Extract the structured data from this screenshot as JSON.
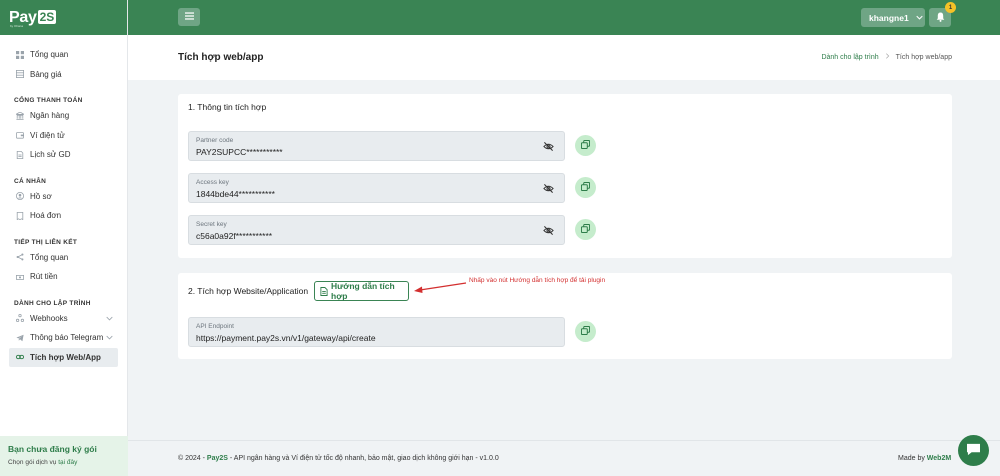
{
  "brand": {
    "logo_text": "Pay",
    "logo_box": "2S",
    "logo_sub": "by Ohana"
  },
  "sidebar": {
    "top_items": [
      {
        "label": "Tổng quan",
        "icon": "grid-icon"
      },
      {
        "label": "Bảng giá",
        "icon": "table-icon"
      }
    ],
    "sections": [
      {
        "title": "CỔNG THANH TOÁN",
        "items": [
          {
            "label": "Ngân hàng",
            "icon": "bank-icon"
          },
          {
            "label": "Ví điện tử",
            "icon": "wallet-icon"
          },
          {
            "label": "Lịch sử GD",
            "icon": "file-icon"
          }
        ]
      },
      {
        "title": "CÁ NHÂN",
        "items": [
          {
            "label": "Hồ sơ",
            "icon": "user-icon"
          },
          {
            "label": "Hoá đơn",
            "icon": "receipt-icon"
          }
        ]
      },
      {
        "title": "TIẾP THỊ LIÊN KẾT",
        "items": [
          {
            "label": "Tổng quan",
            "icon": "network-icon"
          },
          {
            "label": "Rút tiền",
            "icon": "withdraw-icon"
          }
        ]
      },
      {
        "title": "DÀNH CHO LẬP TRÌNH",
        "items": [
          {
            "label": "Webhooks",
            "icon": "webhook-icon"
          },
          {
            "label": "Thông báo Telegram",
            "icon": "telegram-icon"
          },
          {
            "label": "Tích hợp Web/App",
            "icon": "link-icon"
          }
        ]
      }
    ],
    "promo": {
      "title": "Bạn chưa đăng ký gói",
      "sub_text": "Chọn gói dịch vụ ",
      "sub_link": "tại đây"
    }
  },
  "topbar": {
    "username": "khangne1",
    "notification_count": "1"
  },
  "page": {
    "title": "Tích hợp web/app",
    "breadcrumb": {
      "parent": "Dành cho lập trình",
      "current": "Tích hợp web/app"
    }
  },
  "integration_info": {
    "title": "1. Thông tin tích hợp",
    "fields": [
      {
        "label": "Partner code",
        "value": "PAY2SUPCC***********"
      },
      {
        "label": "Access key",
        "value": "1844bde44***********"
      },
      {
        "label": "Secret key",
        "value": "c56a0a92f***********"
      }
    ]
  },
  "website_integration": {
    "title": "2. Tích hợp Website/Application",
    "guide_button": "Hướng dẫn tích hợp",
    "annotation": "Nhấp vào nút Hướng dẫn tích hợp để tải plugin",
    "endpoint": {
      "label": "API Endpoint",
      "value": "https://payment.pay2s.vn/v1/gateway/api/create"
    }
  },
  "footer": {
    "prefix": "© 2024 - ",
    "brand": "Pay2S",
    "text": " - API ngân hàng và Ví điện tử tốc độ nhanh, bảo mật, giao dịch không giới hạn - v1.0.0",
    "made_by_prefix": "Made by ",
    "made_by": "Web2M"
  },
  "colors": {
    "primary": "#3a8454",
    "accent_light": "#c5eccc",
    "annotation": "#d32f2f"
  }
}
